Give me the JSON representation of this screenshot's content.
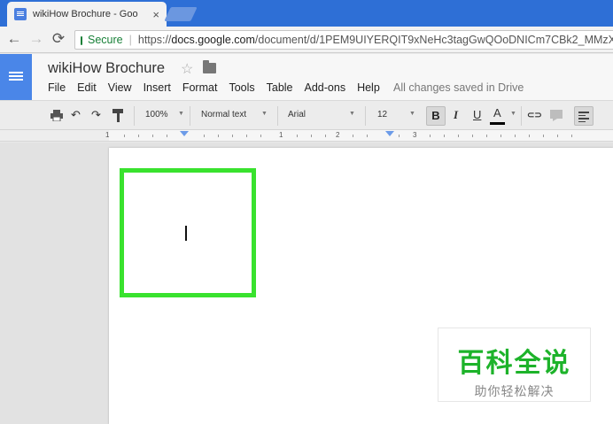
{
  "browser": {
    "tab_title": "wikiHow Brochure - Goo",
    "tab_close": "×",
    "secure_label": "Secure",
    "url_scheme": "https://",
    "url_host": "docs.google.com",
    "url_path": "/document/d/1PEM9UIYERQIT9xNeHc3tagGwQOoDNICm7CBk2_MMzX",
    "back_icon": "←",
    "forward_icon": "→",
    "reload_icon": "⟳"
  },
  "docs": {
    "title": "wikiHow Brochure",
    "star": "☆",
    "menu": [
      "File",
      "Edit",
      "View",
      "Insert",
      "Format",
      "Tools",
      "Table",
      "Add-ons",
      "Help"
    ],
    "save_status": "All changes saved in Drive"
  },
  "toolbar": {
    "zoom": "100%",
    "style": "Normal text",
    "font": "Arial",
    "size": "12",
    "bold": "B",
    "italic": "I",
    "underline": "U",
    "text_color": "A",
    "undo": "↶",
    "redo": "↷",
    "link": "⊂⊃"
  },
  "ruler": {
    "numbers": [
      "1",
      "1",
      "2",
      "3"
    ]
  },
  "highlight_color": "#39e22e",
  "watermark": {
    "main": "百科全说",
    "sub": "助你轻松解决"
  }
}
